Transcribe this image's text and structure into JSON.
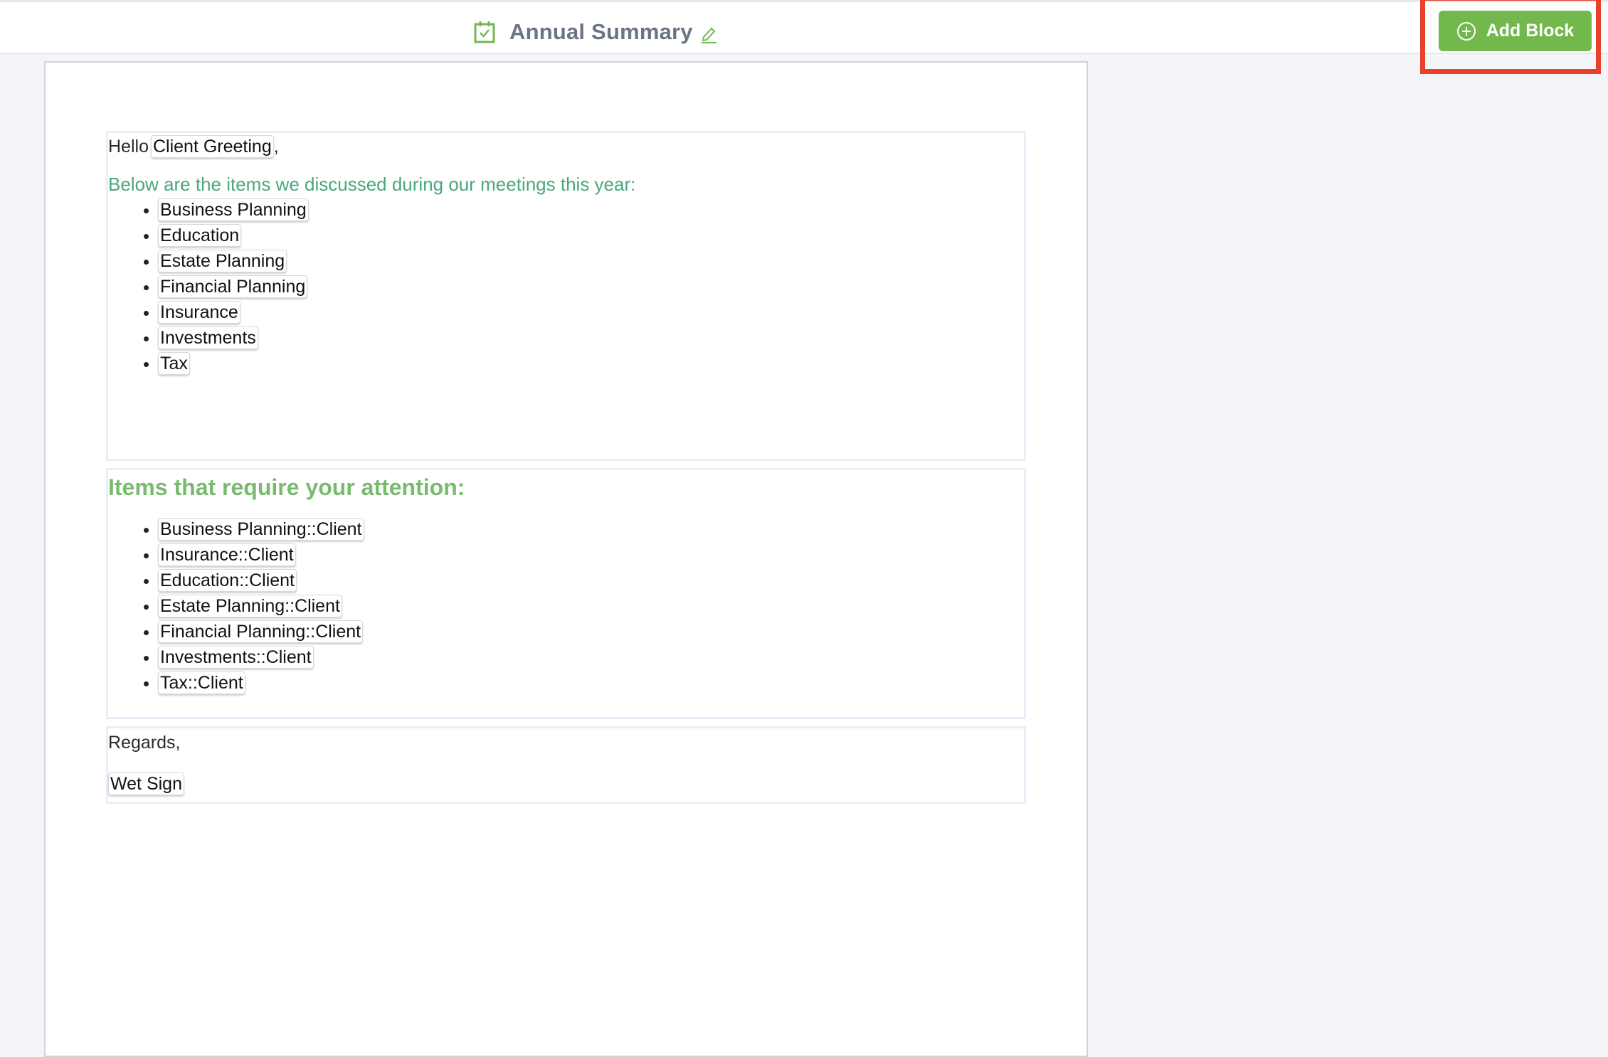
{
  "header": {
    "title": "Annual Summary",
    "title_icon": "calendar-check-icon",
    "edit_icon": "pencil-icon",
    "add_block_label": "Add Block",
    "add_block_icon": "plus-circle-icon"
  },
  "colors": {
    "accent_green": "#72b84c",
    "highlight_red": "#e8402b",
    "teal_text": "#4aa77a",
    "heading_green": "#78bb6e"
  },
  "document": {
    "block1": {
      "greeting_prefix": "Hello",
      "greeting_chip": "Client Greeting",
      "greeting_suffix": ",",
      "intro": "Below are the items we discussed during our meetings this year:",
      "items": [
        "Business Planning",
        "Education",
        "Estate Planning",
        "Financial Planning",
        "Insurance",
        "Investments",
        "Tax"
      ]
    },
    "block2": {
      "heading": "Items that require your attention:",
      "items": [
        "Business Planning::Client",
        "Insurance::Client",
        "Education::Client",
        "Estate Planning::Client",
        "Financial Planning::Client",
        "Investments::Client",
        "Tax::Client"
      ]
    },
    "block3": {
      "closing": "Regards,",
      "signature_chip": "Wet Sign"
    }
  }
}
